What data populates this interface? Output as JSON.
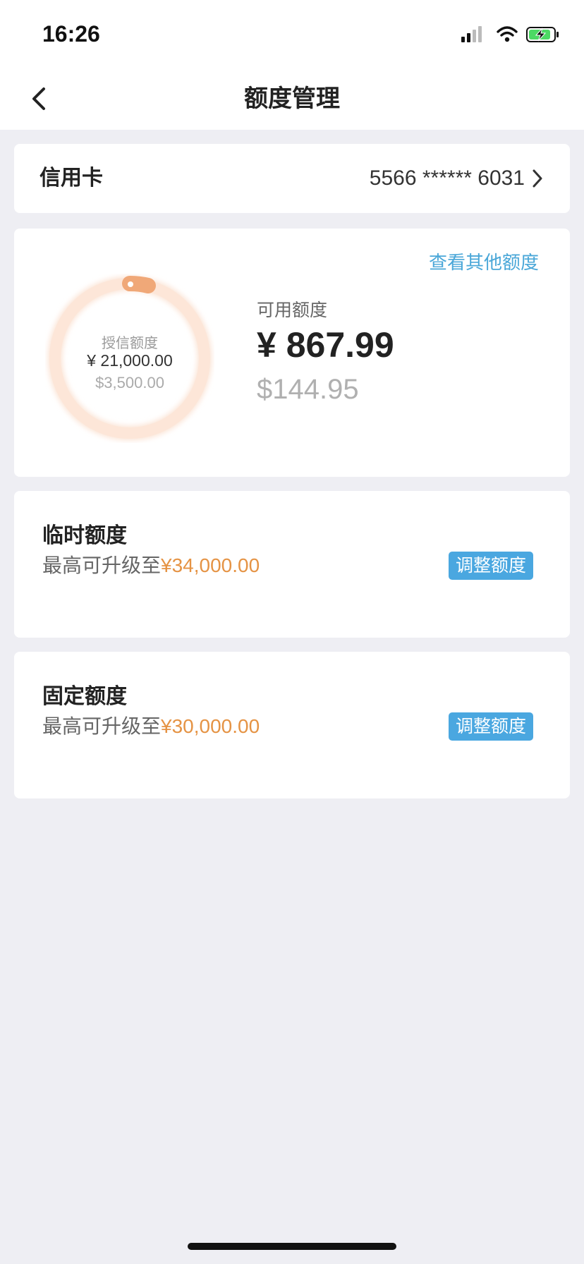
{
  "status_bar": {
    "time": "16:26",
    "icons": [
      "cellular-signal-icon",
      "wifi-icon",
      "battery-charging-icon"
    ]
  },
  "nav": {
    "title": "额度管理",
    "back_icon": "chevron-left-icon"
  },
  "card_selector": {
    "label": "信用卡",
    "card_number": "5566 ****** 6031",
    "icon": "chevron-right-icon"
  },
  "limit_overview": {
    "other_limits_link": "查看其他额度",
    "credit_limit_label": "授信额度",
    "credit_limit_cny": "¥ 21,000.00",
    "credit_limit_usd": "$3,500.00",
    "available_label": "可用额度",
    "available_cny": "¥ 867.99",
    "available_usd": "$144.95",
    "ring_color": "#f0a878",
    "ring_track_color": "#fde6d8"
  },
  "temporary_limit": {
    "title": "临时额度",
    "desc_prefix": "最高可升级至",
    "max_amount": "¥34,000.00",
    "button": "调整额度"
  },
  "fixed_limit": {
    "title": "固定额度",
    "desc_prefix": "最高可升级至",
    "max_amount": "¥30,000.00",
    "button": "调整额度"
  },
  "colors": {
    "accent_blue": "#4aa7e0",
    "accent_orange": "#e59344",
    "background": "#eeeef3"
  }
}
